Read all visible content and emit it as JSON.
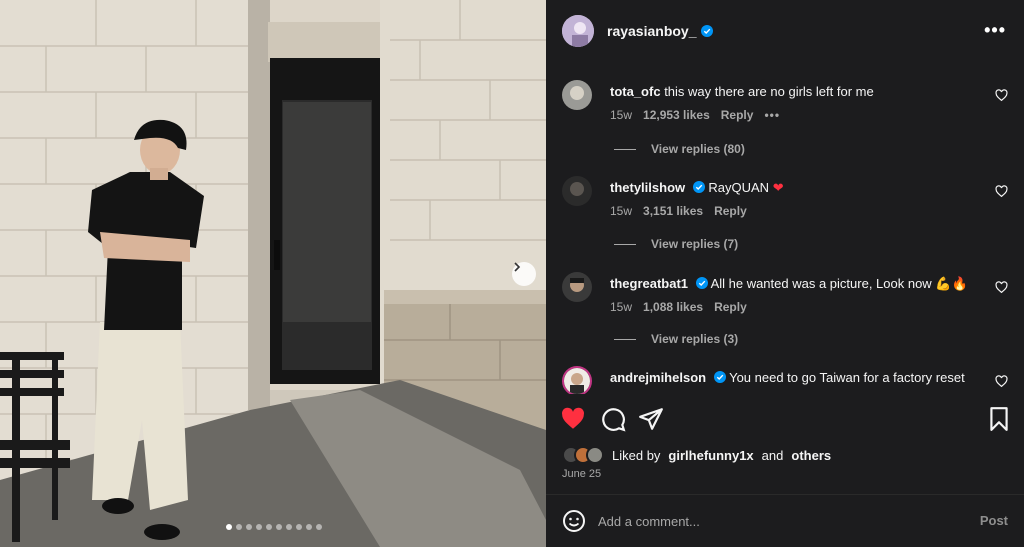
{
  "post": {
    "username": "rayasianboy_",
    "date": "June 25",
    "liked_by_prefix": "Liked by",
    "liked_by_user": "girlhefunny1x",
    "liked_by_and": "and",
    "liked_by_others": "others",
    "carousel_total": 10,
    "carousel_active": 1
  },
  "comments": [
    {
      "author": "tota_ofc",
      "verified": false,
      "text": "this way there are no girls left for me",
      "emoji": "",
      "age": "15w",
      "likes": "12,953 likes",
      "reply": "Reply",
      "more": "•••",
      "view_replies": "View replies (80)"
    },
    {
      "author": "thetylilshow",
      "verified": true,
      "text": "RayQUAN",
      "emoji": "❤",
      "age": "15w",
      "likes": "3,151 likes",
      "reply": "Reply",
      "more": "",
      "view_replies": "View replies (7)"
    },
    {
      "author": "thegreatbat1",
      "verified": true,
      "text": "All he wanted was a picture, Look now",
      "emoji": "💪🔥",
      "age": "15w",
      "likes": "1,088 likes",
      "reply": "Reply",
      "more": "",
      "view_replies": "View replies (3)"
    },
    {
      "author": "andrejmihelson",
      "verified": true,
      "text": "You need to go Taiwan for a factory reset",
      "emoji": "",
      "age": "",
      "likes": "",
      "reply": "",
      "more": "",
      "view_replies": ""
    }
  ],
  "input": {
    "placeholder": "Add a comment..."
  },
  "buttons": {
    "post": "Post",
    "more": "•••"
  },
  "icons": {
    "like": "heart-filled-icon",
    "comment": "comment-bubble-icon",
    "share": "paper-plane-icon",
    "save": "bookmark-icon",
    "emoji": "smiley-icon",
    "next": "chevron-right-icon",
    "verified": "verified-badge-icon"
  },
  "colors": {
    "panel_bg": "#1c1c1e",
    "like_red": "#ff3040",
    "verified_blue": "#0095f6",
    "muted_text": "#a8a8a8"
  }
}
